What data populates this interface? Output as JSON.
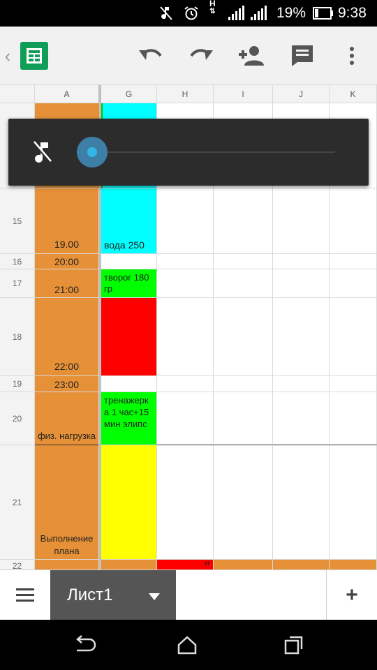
{
  "status": {
    "battery_percent": "19%",
    "time": "9:38",
    "network_label": "H"
  },
  "toolbar": {
    "back": "‹",
    "icons": [
      "sheets-logo-icon",
      "undo-icon",
      "redo-icon",
      "add-person-icon",
      "comment-icon",
      "more-vert-icon"
    ]
  },
  "columns": [
    "A",
    "G",
    "H",
    "I",
    "J",
    "K"
  ],
  "rows": [
    {
      "num": "15",
      "a": "19.00",
      "g": "вода 250",
      "g_color": "#00ffff"
    },
    {
      "num": "16",
      "a": "20:00",
      "g": "",
      "g_color": "#ffffff"
    },
    {
      "num": "17",
      "a": "21:00",
      "g": "творог 180 гр",
      "g_color": "#00ff00"
    },
    {
      "num": "18",
      "a": "22:00",
      "g": "",
      "g_color": "#ff0000"
    },
    {
      "num": "19",
      "a": "23:00",
      "g": "",
      "g_color": "#ffffff"
    },
    {
      "num": "20",
      "a": "физ. нагрузка",
      "g": "тренажерка 1 час+15 мин элипс",
      "g_color": "#00ff00"
    },
    {
      "num": "21",
      "a": "Выполнение плана",
      "g": "",
      "g_color": "#ffff00"
    },
    {
      "num": "22",
      "a": "",
      "g": "",
      "g_color": "#e69138",
      "h": "кг"
    }
  ],
  "volume": {
    "icon": "music-muted-icon",
    "level": 0
  },
  "sheets": {
    "menu_icon": "menu-icon",
    "active_tab": "Лист1",
    "add_label": "+"
  },
  "colors": {
    "orange": "#e69138",
    "cyan": "#00ffff",
    "green": "#00ff00",
    "red": "#ff0000",
    "yellow": "#ffff00",
    "sheets_green": "#0f9d58"
  }
}
